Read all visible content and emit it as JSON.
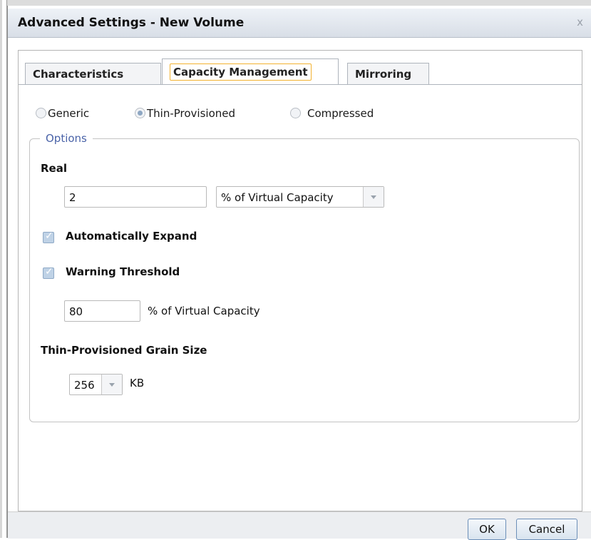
{
  "dialog": {
    "title": "Advanced Settings - New Volume",
    "close_glyph": "x"
  },
  "tabs": [
    {
      "label": "Characteristics",
      "active": false
    },
    {
      "label": "Capacity Management",
      "active": true
    },
    {
      "label": "Mirroring",
      "active": false
    }
  ],
  "provisioning": {
    "options": [
      {
        "label": "Generic",
        "checked": false
      },
      {
        "label": "Thin-Provisioned",
        "checked": true
      },
      {
        "label": "Compressed",
        "checked": false
      }
    ]
  },
  "options_group": {
    "legend": "Options",
    "real_label": "Real",
    "real_value": "2",
    "real_unit": "% of Virtual Capacity",
    "auto_expand_label": "Automatically Expand",
    "auto_expand_checked": true,
    "warning_label": "Warning Threshold",
    "warning_checked": true,
    "warning_value": "80",
    "warning_unit": "% of Virtual Capacity",
    "grain_label": "Thin-Provisioned Grain Size",
    "grain_value": "256",
    "grain_unit": "KB"
  },
  "footer": {
    "ok_label": "OK",
    "cancel_label": "Cancel"
  },
  "icons": {
    "close": "close-icon",
    "dropdown": "chevron-down-icon",
    "check": "checkmark-icon"
  },
  "colors": {
    "focus_outline": "#f2b230",
    "legend": "#4a63a8",
    "button_border": "#6c8fb8"
  }
}
